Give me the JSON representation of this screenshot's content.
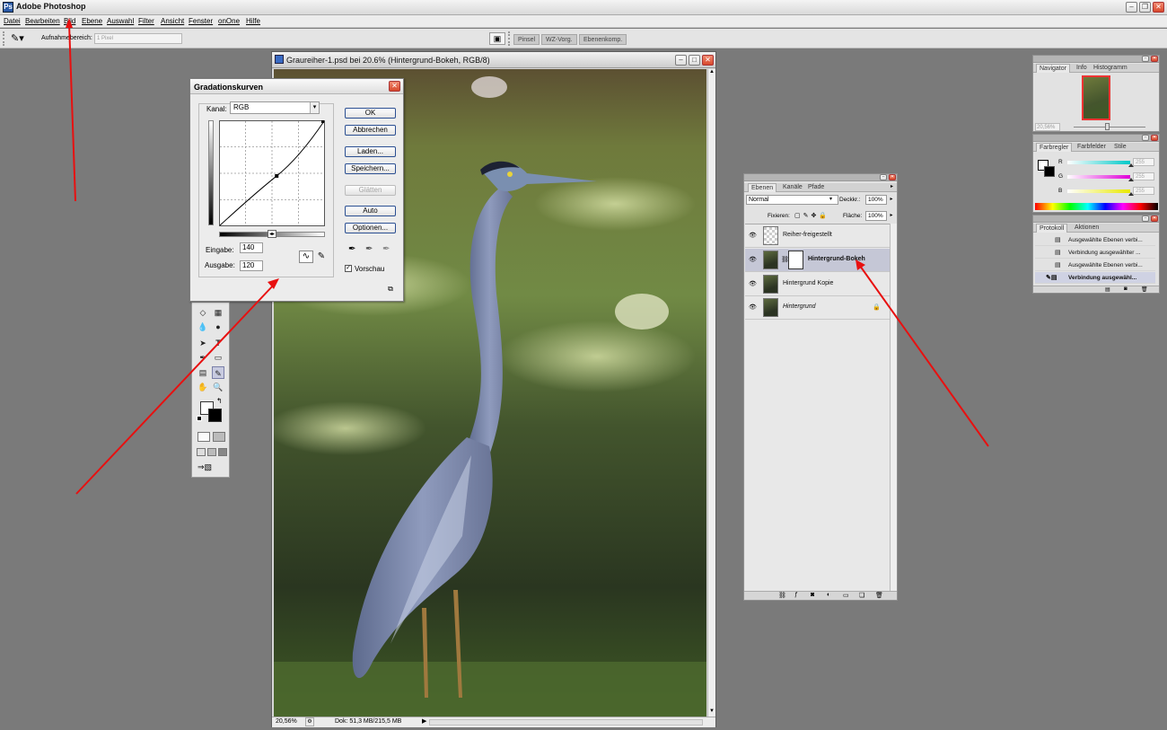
{
  "app": {
    "title": "Adobe Photoshop",
    "icon": "photoshop-icon",
    "window_buttons": [
      "minimize",
      "maximize",
      "close"
    ]
  },
  "menu": {
    "items": [
      "Datei",
      "Bearbeiten",
      "Bild",
      "Ebene",
      "Auswahl",
      "Filter",
      "Ansicht",
      "Fenster",
      "onOne",
      "Hilfe"
    ]
  },
  "options_bar": {
    "tool_icon": "eyedropper-icon",
    "sample_label": "Aufnahmebereich:",
    "sample_value": "1 Pixel",
    "well_tabs": [
      "Pinsel",
      "WZ-Vorg.",
      "Ebenenkomp."
    ]
  },
  "document": {
    "title": "Graureiher-1.psd bei 20.6% (Hintergrund-Bokeh, RGB/8)",
    "zoom": "20,56%",
    "doc_info": "Dok: 51,3 MB/215,5 MB"
  },
  "curves_dialog": {
    "title": "Gradationskurven",
    "channel_label": "Kanal:",
    "channel_value": "RGB",
    "buttons": {
      "ok": "OK",
      "cancel": "Abbrechen",
      "load": "Laden...",
      "save": "Speichern...",
      "smooth": "Glätten",
      "auto": "Auto",
      "options": "Optionen..."
    },
    "input_label": "Eingabe:",
    "input_value": "140",
    "output_label": "Ausgabe:",
    "output_value": "120",
    "preview_label": "Vorschau",
    "preview_checked": true,
    "curve_point": {
      "input": 140,
      "output": 120
    }
  },
  "layers_panel": {
    "tabs": [
      "Ebenen",
      "Kanäle",
      "Pfade"
    ],
    "blend_mode": "Normal",
    "opacity_label": "Deckkr.:",
    "opacity_value": "100%",
    "lock_label": "Fixieren:",
    "fill_label": "Fläche:",
    "fill_value": "100%",
    "layers": [
      {
        "name": "Reiher-freigestellt",
        "selected": false,
        "has_mask": false
      },
      {
        "name": "Hintergrund-Bokeh",
        "selected": true,
        "has_mask": true
      },
      {
        "name": "Hintergrund Kopie",
        "selected": false,
        "has_mask": false
      },
      {
        "name": "Hintergrund",
        "selected": false,
        "has_mask": false,
        "locked": true
      }
    ]
  },
  "navigator_panel": {
    "tabs": [
      "Navigator",
      "Info",
      "Histogramm"
    ],
    "zoom": "20,56%"
  },
  "color_panel": {
    "tabs": [
      "Farbregler",
      "Farbfelder",
      "Stile"
    ],
    "channels": [
      {
        "label": "R",
        "value": "255",
        "color": "#00c8c8"
      },
      {
        "label": "G",
        "value": "255",
        "color": "#e000d8"
      },
      {
        "label": "B",
        "value": "255",
        "color": "#e8e800"
      }
    ]
  },
  "history_panel": {
    "tabs": [
      "Protokoll",
      "Aktionen"
    ],
    "items": [
      "Ausgewählte Ebenen verbi...",
      "Verbindung ausgewählter ...",
      "Ausgewählte Ebenen verbi...",
      "Verbindung ausgewähl..."
    ]
  },
  "annotations": {
    "color": "#e81010"
  }
}
